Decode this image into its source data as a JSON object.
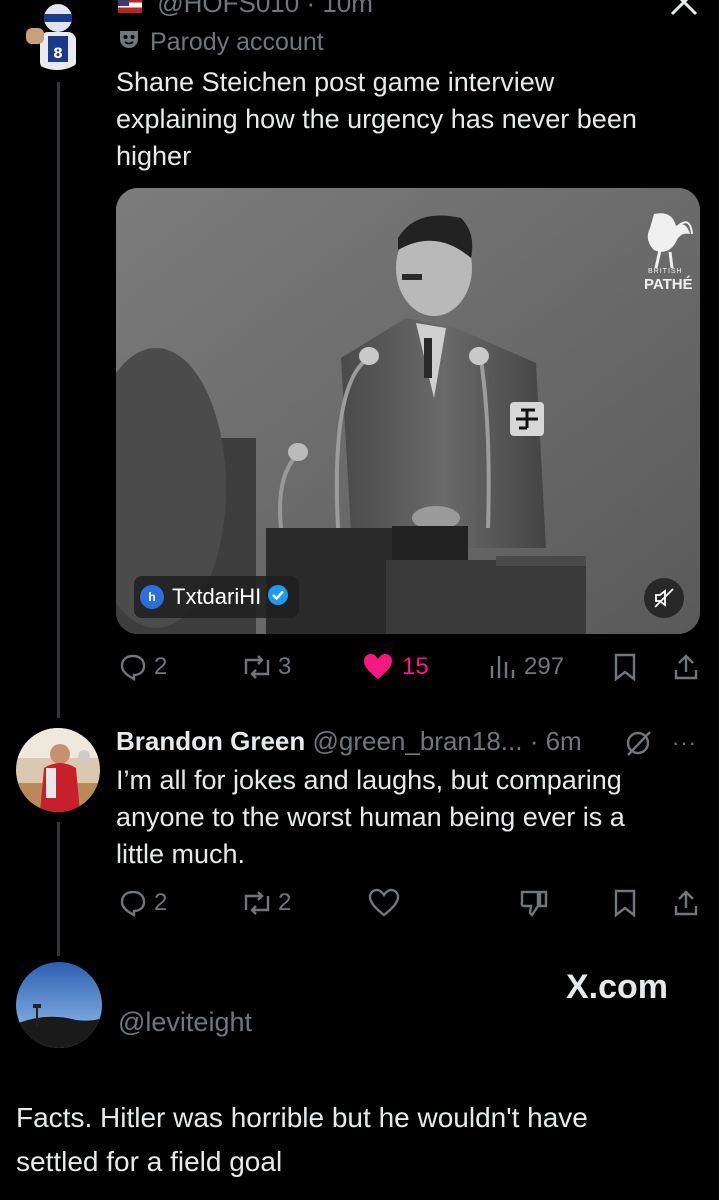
{
  "tweet1": {
    "handle_time": "@HOFS010 · 10m",
    "parody_label": "Parody account",
    "text_line1": "Shane Steichen post game interview",
    "text_line2": "explaining how the urgency has never been",
    "text_line3": "higher",
    "media": {
      "watermark_small": "BRITISH",
      "watermark": "PATHÉ",
      "source_tag": "TxtdariHI"
    },
    "actions": {
      "replies": "2",
      "reposts": "3",
      "likes": "15",
      "views": "297"
    }
  },
  "tweet2": {
    "name": "Brandon Green",
    "handle_time": "@green_bran18... · 6m",
    "text_line1": "I’m all for jokes and laughs, but comparing",
    "text_line2": "anyone to the worst human being ever is a",
    "text_line3": "little much.",
    "actions": {
      "replies": "2",
      "reposts": "2"
    }
  },
  "tweet3": {
    "handle": "@leviteight",
    "brand": "X.com",
    "text_line1": "Facts. Hitler was horrible but he wouldn't have",
    "text_line2": "settled for a field goal"
  },
  "colors": {
    "like": "#f91880",
    "verified": "#1d9bf0",
    "text": "#e7e9ea",
    "muted": "#71767b"
  }
}
